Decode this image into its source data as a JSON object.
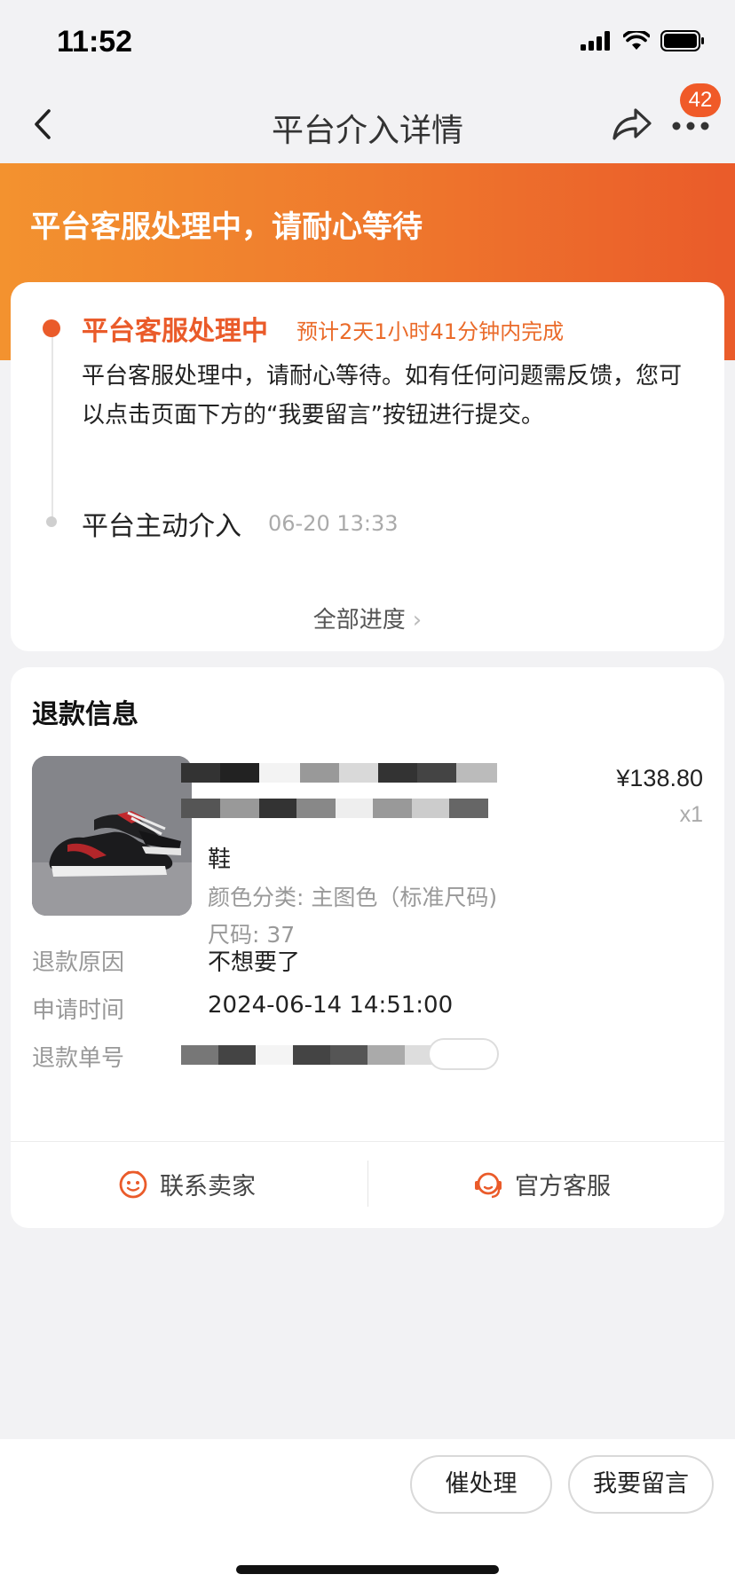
{
  "status_bar": {
    "time": "11:52"
  },
  "nav": {
    "title": "平台介入详情",
    "badge_count": "42"
  },
  "banner": {
    "text": "平台客服处理中，请耐心等待"
  },
  "progress": {
    "current": {
      "title": "平台客服处理中",
      "eta": "预计2天1小时41分钟内完成",
      "desc": "平台客服处理中，请耐心等待。如有任何问题需反馈，您可以点击页面下方的“我要留言”按钮进行提交。"
    },
    "previous": {
      "title": "平台主动介入",
      "time": "06-20 13:33"
    },
    "view_all": "全部进度"
  },
  "refund": {
    "title": "退款信息",
    "product": {
      "name": "鞋",
      "spec": "颜色分类: 主图色（标准尺码)",
      "size": "尺码: 37",
      "price": "¥138.80",
      "qty": "x1"
    },
    "reason_label": "退款原因",
    "reason_value": "不想要了",
    "time_label": "申请时间",
    "time_value": "2024-06-14 14:51:00",
    "number_label": "退款单号"
  },
  "actions": {
    "contact_seller": "联系卖家",
    "official_service": "官方客服"
  },
  "bottom": {
    "urge": "催处理",
    "message": "我要留言"
  },
  "colors": {
    "accent": "#ea5b2a",
    "banner_start": "#f3922f",
    "banner_end": "#ea5b2a"
  }
}
